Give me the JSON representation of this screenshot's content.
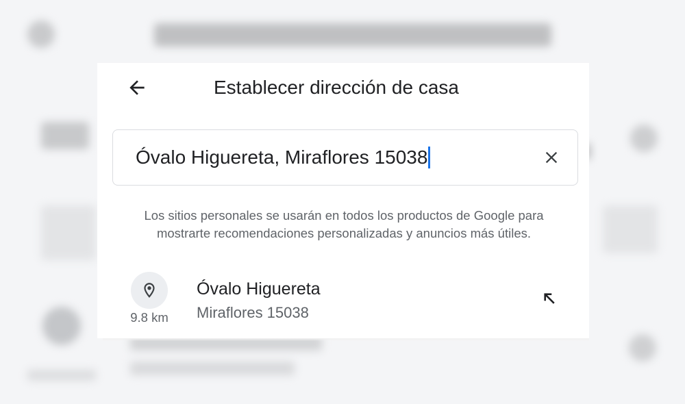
{
  "dialog": {
    "title": "Establecer dirección de casa",
    "back_icon": "arrow-back-icon"
  },
  "search": {
    "value": "Óvalo Higuereta, Miraflores 15038",
    "clear_icon": "close-icon",
    "caret_color": "#1a73e8"
  },
  "info_text": "Los sitios personales se usarán en todos los productos de Google para mostrarte recomendaciones personalizadas y anuncios más útiles.",
  "results": [
    {
      "name": "Óvalo Higuereta",
      "address": "Miraflores 15038",
      "distance": "9.8 km",
      "icon": "location-pin-icon",
      "action_icon": "arrow-up-left-icon"
    }
  ],
  "colors": {
    "text_primary": "#202124",
    "text_secondary": "#5f6368",
    "border": "#dadce0",
    "icon_bg": "#eceef1"
  }
}
